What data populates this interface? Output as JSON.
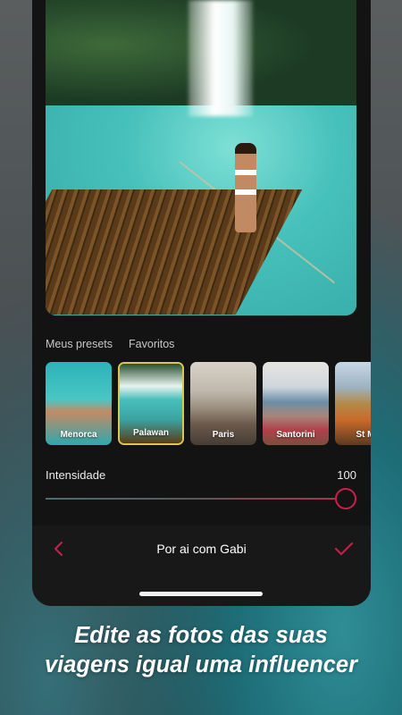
{
  "preset_tabs": [
    {
      "label": "Meus presets"
    },
    {
      "label": "Favoritos"
    }
  ],
  "presets": [
    {
      "label": "Menorca"
    },
    {
      "label": "Palawan",
      "selected": true
    },
    {
      "label": "Paris"
    },
    {
      "label": "Santorini"
    },
    {
      "label": "St Mo"
    }
  ],
  "intensity": {
    "label": "Intensidade",
    "value": "100",
    "level": 1.0
  },
  "bottom_bar": {
    "title": "Por ai com Gabi",
    "back_icon": "chevron-left-icon",
    "confirm_icon": "checkmark-icon"
  },
  "caption": {
    "line1": "Edite as fotos das suas",
    "line2": "viagens igual uma influencer"
  },
  "colors": {
    "accent": "#c91f4d",
    "selected_border": "#d9c84a",
    "app_bg": "#131314"
  }
}
